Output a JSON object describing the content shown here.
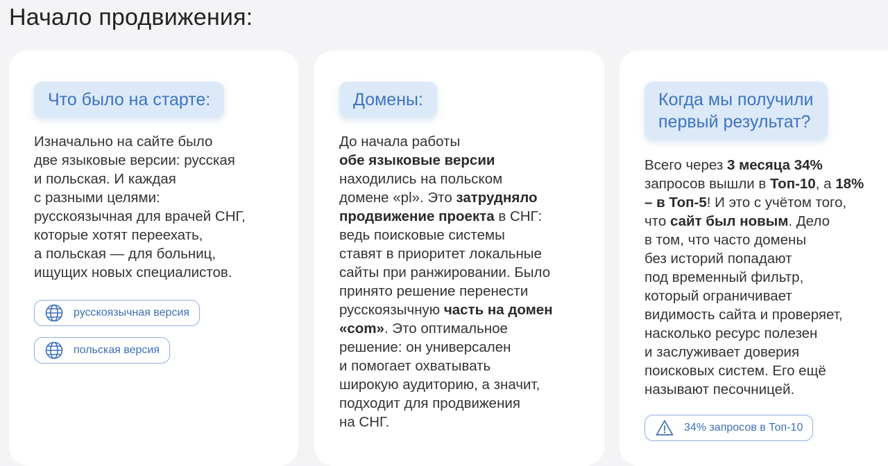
{
  "page": {
    "title": "Начало продвижения:"
  },
  "cards": [
    {
      "heading": "Что было на старте:",
      "paragraph": [
        {
          "text": "Изначально на сайте было\nдве языковые версии: русская\nи польская. И каждая\nс разными целями:\nрусскоязычная для врачей СНГ,\nкоторые хотят переехать,\nа польская — для больниц,\nищущих новых специалистов.",
          "bold": false
        }
      ],
      "buttons": [
        {
          "label": "русскоязычная версия",
          "icon": "globe-icon"
        },
        {
          "label": "польская версия",
          "icon": "globe-icon"
        }
      ]
    },
    {
      "heading": "Домены:",
      "paragraph": [
        {
          "text": "До начала работы\n",
          "bold": false
        },
        {
          "text": "обе языковые версии",
          "bold": true
        },
        {
          "text": "\nнаходились на польском\nдомене «pl». Это ",
          "bold": false
        },
        {
          "text": "затрудняло\nпродвижение проекта",
          "bold": true
        },
        {
          "text": " в СНГ:\nведь поисковые системы\nставят в приоритет локальные\nсайты при ранжировании. Было\nпринято решение перенести\nрусскоязычную ",
          "bold": false
        },
        {
          "text": "часть на домен\n«com»",
          "bold": true
        },
        {
          "text": ". Это оптимальное\nрешение: он универсален\nи помогает охватывать\nширокую аудиторию, а значит,\nподходит для продвижения\nна СНГ.",
          "bold": false
        }
      ]
    },
    {
      "heading": "Когда мы получили\nпервый результат?",
      "paragraph": [
        {
          "text": "Всего через ",
          "bold": false
        },
        {
          "text": "3 месяца 34%",
          "bold": true
        },
        {
          "text": "\nзапросов вышли в ",
          "bold": false
        },
        {
          "text": "Топ-10",
          "bold": true
        },
        {
          "text": ", а ",
          "bold": false
        },
        {
          "text": "18%\n– в Топ-5",
          "bold": true
        },
        {
          "text": "! И это с учётом того,\nчто ",
          "bold": false
        },
        {
          "text": "сайт был новым",
          "bold": true
        },
        {
          "text": ". Дело\nв том, что часто домены\nбез историй попадают\nпод временный фильтр,\nкоторый ограничивает\nвидимость сайта и проверяет,\nнасколько ресурс полезен\nи заслуживает доверия\nпоисковых систем. Его ещё\nназывают песочницей.",
          "bold": false
        }
      ],
      "buttons": [
        {
          "label": "34% запросов в Топ-10",
          "icon": "warning-triangle-icon"
        }
      ]
    }
  ],
  "colors": {
    "accent": "#3e73c3",
    "heading_bg": "#dce9f8",
    "pill_border": "#8fb0df",
    "card_bg": "#ffffff",
    "page_bg": "#f4f4f6"
  }
}
